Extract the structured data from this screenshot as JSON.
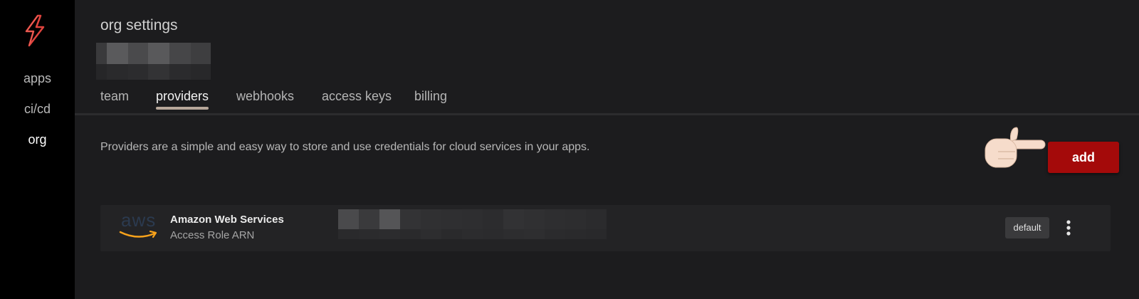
{
  "sidebar": {
    "items": [
      {
        "label": "apps",
        "active": false
      },
      {
        "label": "ci/cd",
        "active": false
      },
      {
        "label": "org",
        "active": true
      }
    ]
  },
  "header": {
    "title": "org settings"
  },
  "tabs": [
    {
      "label": "team",
      "active": false
    },
    {
      "label": "providers",
      "active": true
    },
    {
      "label": "webhooks",
      "active": false
    },
    {
      "label": "access keys",
      "active": false
    },
    {
      "label": "billing",
      "active": false
    }
  ],
  "providers_page": {
    "description": "Providers are a simple and easy way to store and use credentials for cloud services in your apps.",
    "add_label": "add",
    "pointer_icon": "hand-pointing-right"
  },
  "provider_list": [
    {
      "logo_text": "aws",
      "name": "Amazon Web Services",
      "type": "Access Role ARN",
      "badge": "default",
      "value_redacted": true
    }
  ],
  "colors": {
    "sidebar_bg": "#000000",
    "main_bg": "#1c1c1e",
    "accent_red": "#a40a0a",
    "tab_underline": "#b7a79a",
    "aws_orange": "#f7a21b"
  }
}
